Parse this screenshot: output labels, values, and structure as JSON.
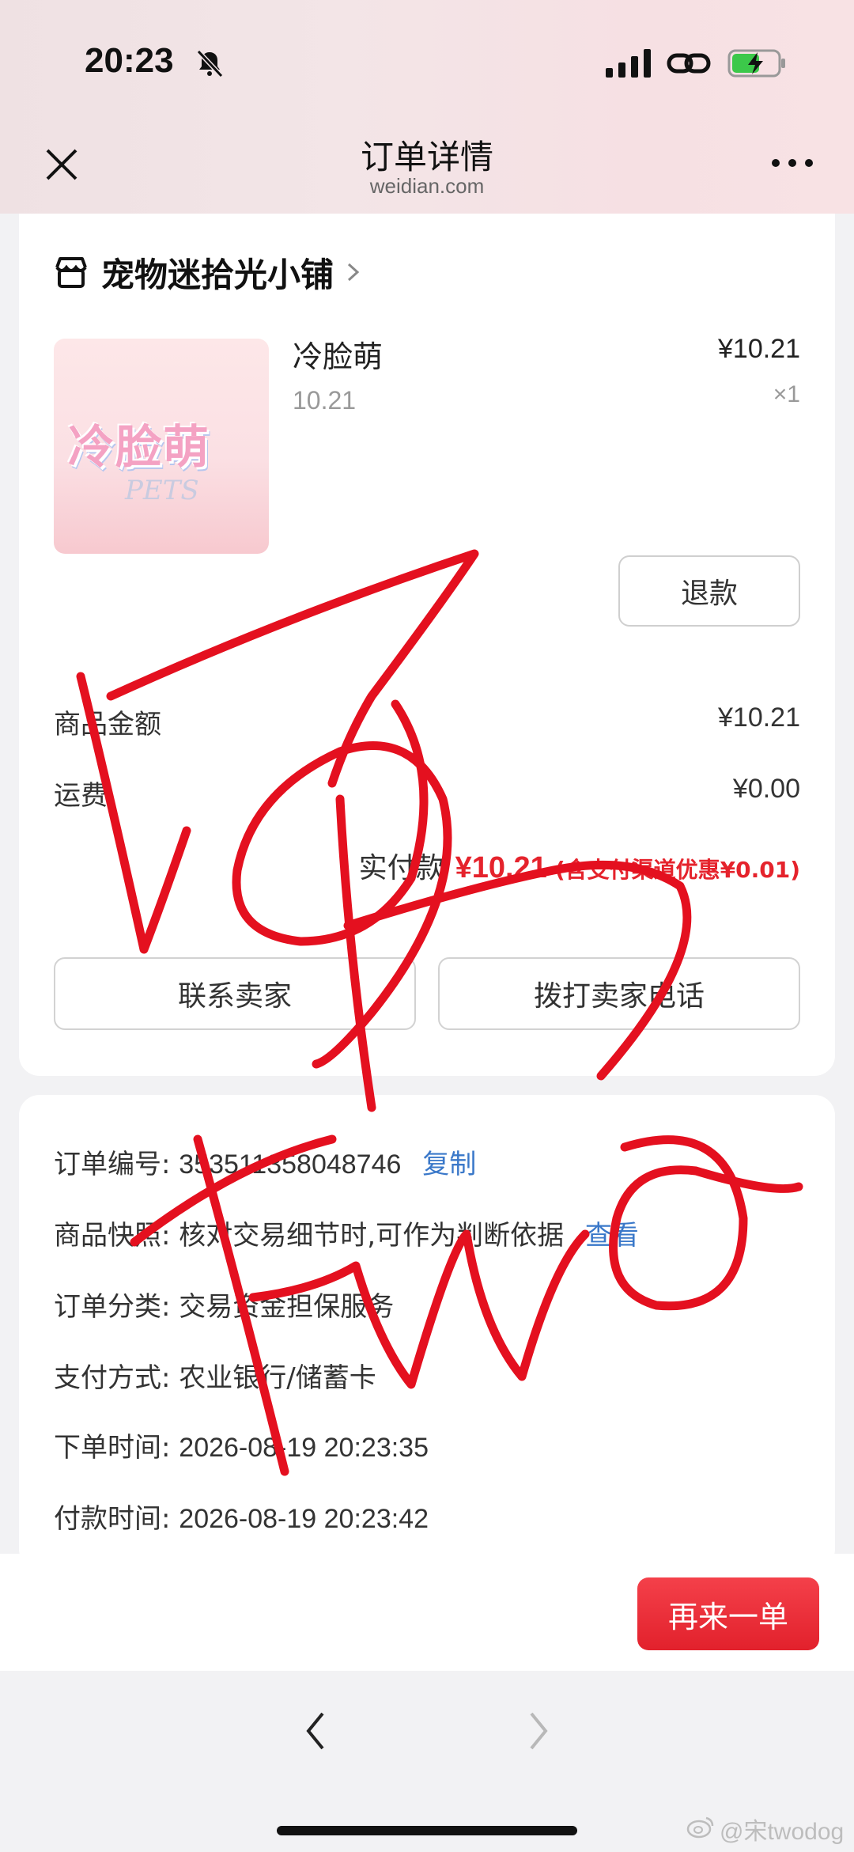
{
  "status_bar": {
    "time": "20:23"
  },
  "nav": {
    "title": "订单详情",
    "subtitle": "weidian.com"
  },
  "shop": {
    "name": "宠物迷拾光小铺"
  },
  "product": {
    "title": "冷脸萌",
    "spec": "10.21",
    "price": "¥10.21",
    "qty": "×1",
    "image_text": "冷脸萌",
    "image_script": "PETS"
  },
  "refund_label": "退款",
  "summary": {
    "goods_label": "商品金额",
    "goods_value": "¥10.21",
    "shipping_label": "运费",
    "shipping_value": "¥0.00",
    "paid_label": "实付款",
    "paid_value": "¥10.21",
    "paid_note": "(含支付渠道优惠¥0.01)"
  },
  "actions": {
    "contact_seller": "联系卖家",
    "call_seller": "拨打卖家电话"
  },
  "info": {
    "order_no_label": "订单编号:",
    "order_no_value": "353511358048746",
    "copy_label": "复制",
    "snapshot_label": "商品快照:",
    "snapshot_value": "核对交易细节时,可作为判断依据",
    "view_label": "查看",
    "category_label": "订单分类:",
    "category_value": "交易资金担保服务",
    "pay_method_label": "支付方式:",
    "pay_method_value": "农业银行/储蓄卡",
    "order_time_label": "下单时间:",
    "order_time_value": "2026-08-19 20:23:35",
    "pay_time_label": "付款时间:",
    "pay_time_value": "2026-08-19 20:23:42"
  },
  "reorder_label": "再来一单",
  "watermark": "@宋twodog",
  "colors": {
    "accent_red": "#e5232c",
    "link_blue": "#3a78c9",
    "header_pink": "#f3e5e7"
  }
}
